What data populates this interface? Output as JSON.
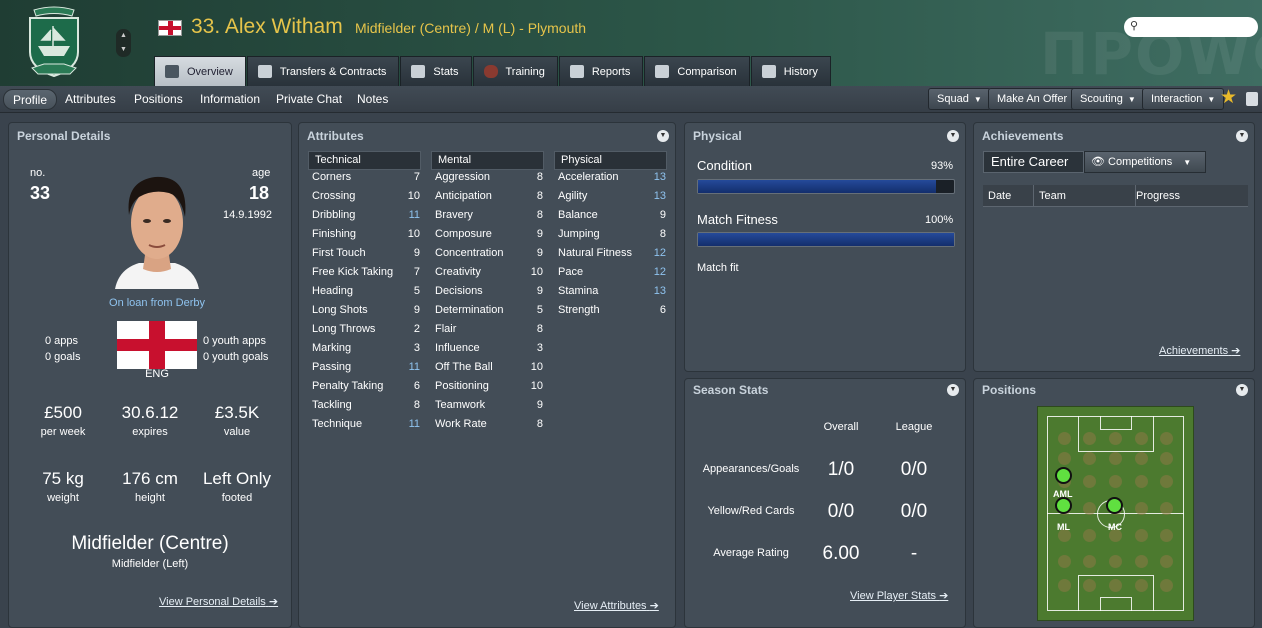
{
  "header": {
    "name": "33. Alex Witham",
    "subtitle": "Midfielder (Centre) / M (L) - Plymouth",
    "watermark": "ΠPOWC",
    "crest_caption": "125 YEARS"
  },
  "tabs": [
    {
      "label": "Overview",
      "icon": "overview-icon"
    },
    {
      "label": "Transfers & Contracts",
      "icon": "contract-icon"
    },
    {
      "label": "Stats",
      "icon": "stats-icon"
    },
    {
      "label": "Training",
      "icon": "training-icon"
    },
    {
      "label": "Reports",
      "icon": "reports-icon"
    },
    {
      "label": "Comparison",
      "icon": "comparison-icon"
    },
    {
      "label": "History",
      "icon": "history-icon"
    }
  ],
  "subtabs": [
    "Profile",
    "Attributes",
    "Positions",
    "Information",
    "Private Chat",
    "Notes"
  ],
  "actions": {
    "squad": "Squad",
    "make_offer": "Make An Offer",
    "scouting": "Scouting",
    "interaction": "Interaction"
  },
  "personal": {
    "title": "Personal Details",
    "no_label": "no.",
    "no": "33",
    "age_label": "age",
    "age": "18",
    "dob": "14.9.1992",
    "loan": "On loan from Derby",
    "apps": "0 apps",
    "goals": "0 goals",
    "youth_apps": "0 youth apps",
    "youth_goals": "0 youth goals",
    "nation": "ENG",
    "wage": "£500",
    "wage_label": "per week",
    "expires": "30.6.12",
    "expires_label": "expires",
    "value": "£3.5K",
    "value_label": "value",
    "weight": "75 kg",
    "weight_label": "weight",
    "height": "176 cm",
    "height_label": "height",
    "foot": "Left Only",
    "foot_label": "footed",
    "position": "Midfielder (Centre)",
    "position2": "Midfielder (Left)",
    "link": "View Personal Details"
  },
  "attributes": {
    "title": "Attributes",
    "technical_label": "Technical",
    "mental_label": "Mental",
    "physical_label": "Physical",
    "technical": [
      {
        "n": "Corners",
        "v": "7",
        "h": false
      },
      {
        "n": "Crossing",
        "v": "10",
        "h": false
      },
      {
        "n": "Dribbling",
        "v": "11",
        "h": true
      },
      {
        "n": "Finishing",
        "v": "10",
        "h": false
      },
      {
        "n": "First Touch",
        "v": "9",
        "h": false
      },
      {
        "n": "Free Kick Taking",
        "v": "7",
        "h": false
      },
      {
        "n": "Heading",
        "v": "5",
        "h": false
      },
      {
        "n": "Long Shots",
        "v": "9",
        "h": false
      },
      {
        "n": "Long Throws",
        "v": "2",
        "h": false
      },
      {
        "n": "Marking",
        "v": "3",
        "h": false
      },
      {
        "n": "Passing",
        "v": "11",
        "h": true
      },
      {
        "n": "Penalty Taking",
        "v": "6",
        "h": false
      },
      {
        "n": "Tackling",
        "v": "8",
        "h": false
      },
      {
        "n": "Technique",
        "v": "11",
        "h": true
      }
    ],
    "mental": [
      {
        "n": "Aggression",
        "v": "8",
        "h": false
      },
      {
        "n": "Anticipation",
        "v": "8",
        "h": false
      },
      {
        "n": "Bravery",
        "v": "8",
        "h": false
      },
      {
        "n": "Composure",
        "v": "9",
        "h": false
      },
      {
        "n": "Concentration",
        "v": "9",
        "h": false
      },
      {
        "n": "Creativity",
        "v": "10",
        "h": false
      },
      {
        "n": "Decisions",
        "v": "9",
        "h": false
      },
      {
        "n": "Determination",
        "v": "5",
        "h": false
      },
      {
        "n": "Flair",
        "v": "8",
        "h": false
      },
      {
        "n": "Influence",
        "v": "3",
        "h": false
      },
      {
        "n": "Off The Ball",
        "v": "10",
        "h": false
      },
      {
        "n": "Positioning",
        "v": "10",
        "h": false
      },
      {
        "n": "Teamwork",
        "v": "9",
        "h": false
      },
      {
        "n": "Work Rate",
        "v": "8",
        "h": false
      }
    ],
    "physical": [
      {
        "n": "Acceleration",
        "v": "13",
        "h": true
      },
      {
        "n": "Agility",
        "v": "13",
        "h": true
      },
      {
        "n": "Balance",
        "v": "9",
        "h": false
      },
      {
        "n": "Jumping",
        "v": "8",
        "h": false
      },
      {
        "n": "Natural Fitness",
        "v": "12",
        "h": true
      },
      {
        "n": "Pace",
        "v": "12",
        "h": true
      },
      {
        "n": "Stamina",
        "v": "13",
        "h": true
      },
      {
        "n": "Strength",
        "v": "6",
        "h": false
      }
    ],
    "link": "View Attributes"
  },
  "physical": {
    "title": "Physical",
    "condition_label": "Condition",
    "condition": "93%",
    "condition_value": 0.93,
    "fitness_label": "Match Fitness",
    "fitness": "100%",
    "fitness_value": 1.0,
    "status": "Match fit"
  },
  "achievements": {
    "title": "Achievements",
    "scope": "Entire Career",
    "filter": "Competitions",
    "col_date": "Date",
    "col_team": "Team",
    "col_progress": "Progress",
    "link": "Achievements"
  },
  "season": {
    "title": "Season Stats",
    "col_overall": "Overall",
    "col_league": "League",
    "rows": [
      {
        "label": "Appearances/Goals",
        "overall": "1/0",
        "league": "0/0"
      },
      {
        "label": "Yellow/Red Cards",
        "overall": "0/0",
        "league": "0/0"
      },
      {
        "label": "Average Rating",
        "overall": "6.00",
        "league": "-"
      }
    ],
    "link": "View Player Stats"
  },
  "positions": {
    "title": "Positions",
    "labels": [
      "AML",
      "ML",
      "MC"
    ]
  },
  "colors": {
    "accent": "#e6c44a",
    "highlight": "#8fc3ef",
    "bar_fill": "#1f3f8a",
    "pitch": "#4c7a2f",
    "position_dot": "#60e040"
  }
}
